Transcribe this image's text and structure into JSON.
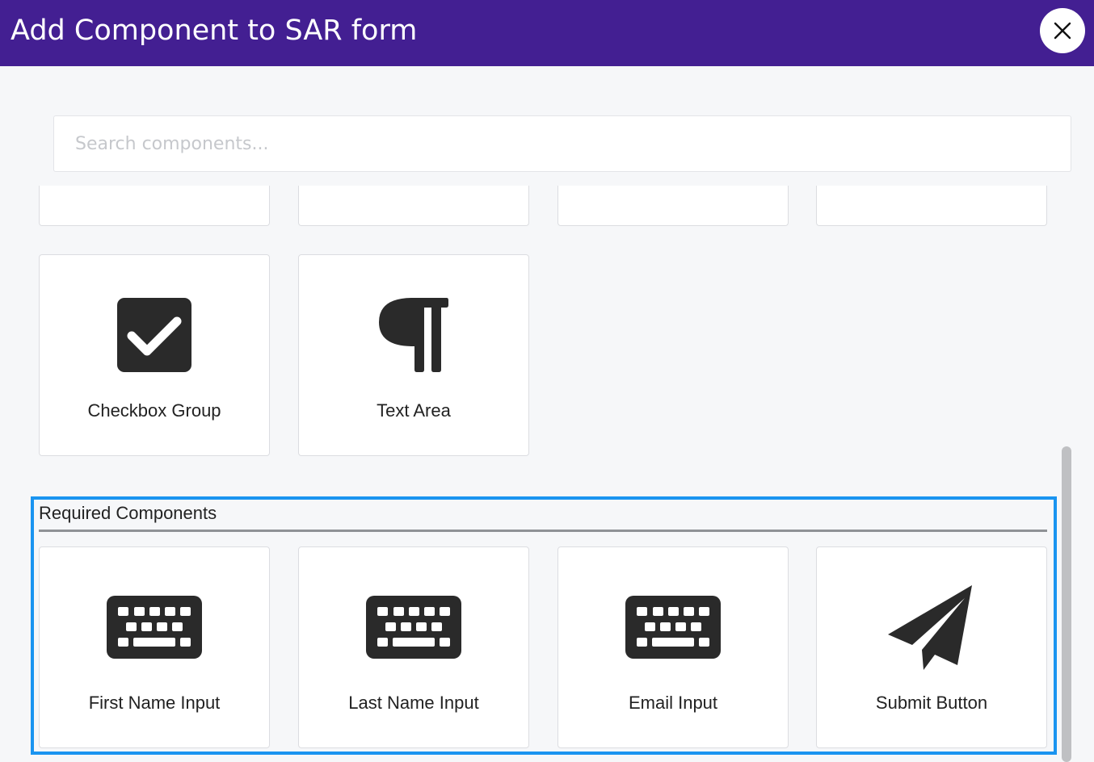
{
  "header": {
    "title": "Add Component to SAR form",
    "close_icon": "close-icon",
    "color": "#431f92"
  },
  "search": {
    "placeholder": "Search components..."
  },
  "components": [
    {
      "label": "Checkbox Group",
      "icon": "checkbox-checked-icon"
    },
    {
      "label": "Text Area",
      "icon": "paragraph-icon"
    }
  ],
  "required_section": {
    "title": "Required Components",
    "items": [
      {
        "label": "First Name Input",
        "icon": "keyboard-icon"
      },
      {
        "label": "Last Name Input",
        "icon": "keyboard-icon"
      },
      {
        "label": "Email Input",
        "icon": "keyboard-icon"
      },
      {
        "label": "Submit Button",
        "icon": "paper-plane-icon"
      }
    ]
  },
  "colors": {
    "highlight": "#1a94f0",
    "icon": "#2a2a2a"
  }
}
